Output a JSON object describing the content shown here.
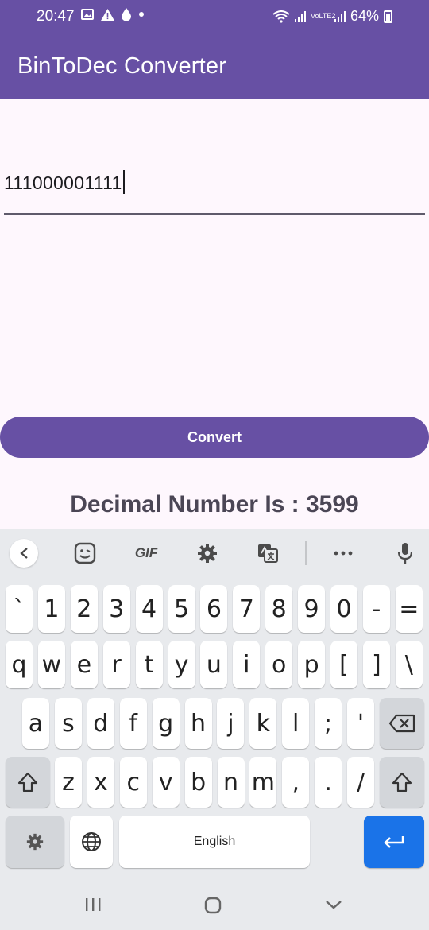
{
  "status_bar": {
    "time": "20:47",
    "network_badge": "VoLTE2",
    "battery": "64%"
  },
  "app": {
    "title": "BinToDec Converter"
  },
  "main": {
    "binary_input": "111000001111",
    "convert_label": "Convert",
    "result_text": "Decimal Number Is : 3599"
  },
  "keyboard": {
    "toolbar": [
      "back",
      "emoji",
      "GIF",
      "settings",
      "translate",
      "more",
      "mic"
    ],
    "gif_label": "GIF",
    "row1": [
      "`",
      "1",
      "2",
      "3",
      "4",
      "5",
      "6",
      "7",
      "8",
      "9",
      "0",
      "-",
      "="
    ],
    "row2": [
      "q",
      "w",
      "e",
      "r",
      "t",
      "y",
      "u",
      "i",
      "o",
      "p",
      "[",
      "]",
      "\\"
    ],
    "row3": [
      "a",
      "s",
      "d",
      "f",
      "g",
      "h",
      "j",
      "k",
      "l",
      ";",
      "'"
    ],
    "row4": [
      "z",
      "x",
      "c",
      "v",
      "b",
      "n",
      "m",
      ",",
      ".",
      "/"
    ],
    "space_label": "English"
  },
  "colors": {
    "primary": "#6750a4",
    "background": "#fef7fd",
    "keyboard_bg": "#e8eaed",
    "enter_key": "#1a73e8"
  }
}
